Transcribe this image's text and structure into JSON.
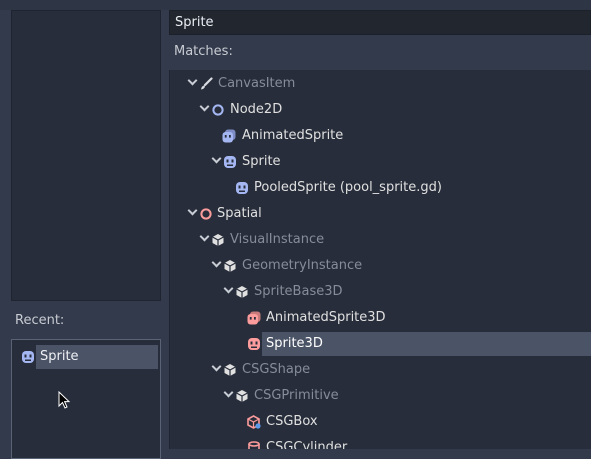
{
  "search": {
    "value": "Sprite"
  },
  "matches_label": "Matches:",
  "recent": {
    "label": "Recent:",
    "items": [
      {
        "label": "Sprite",
        "icon": "sprite-2d-icon"
      }
    ]
  },
  "tree": {
    "rows": [
      {
        "label": "CanvasItem",
        "icon": "brush-icon",
        "disabled": true,
        "arrow": true
      },
      {
        "label": "Node2D",
        "icon": "node2d-circle-icon",
        "disabled": false,
        "arrow": true
      },
      {
        "label": "AnimatedSprite",
        "icon": "animated-sprite-2d-icon",
        "disabled": false,
        "arrow": false
      },
      {
        "label": "Sprite",
        "icon": "sprite-2d-icon",
        "disabled": false,
        "arrow": true
      },
      {
        "label": "PooledSprite (pool_sprite.gd)",
        "icon": "sprite-2d-icon",
        "disabled": false,
        "arrow": false
      },
      {
        "label": "Spatial",
        "icon": "spatial-circle-icon",
        "disabled": false,
        "arrow": true
      },
      {
        "label": "VisualInstance",
        "icon": "cube-icon",
        "disabled": true,
        "arrow": true
      },
      {
        "label": "GeometryInstance",
        "icon": "cube-icon",
        "disabled": true,
        "arrow": true
      },
      {
        "label": "SpriteBase3D",
        "icon": "cube-icon",
        "disabled": true,
        "arrow": true
      },
      {
        "label": "AnimatedSprite3D",
        "icon": "animated-sprite-3d-icon",
        "disabled": false,
        "arrow": false
      },
      {
        "label": "Sprite3D",
        "icon": "sprite-3d-icon",
        "disabled": false,
        "arrow": false,
        "selected": true
      },
      {
        "label": "CSGShape",
        "icon": "cube-icon",
        "disabled": true,
        "arrow": true
      },
      {
        "label": "CSGPrimitive",
        "icon": "cube-icon",
        "disabled": true,
        "arrow": true
      },
      {
        "label": "CSGBox",
        "icon": "csg-box-icon",
        "disabled": false,
        "arrow": false
      },
      {
        "label": "CSGCylinder",
        "icon": "csg-cylinder-icon",
        "disabled": false,
        "arrow": false
      }
    ]
  },
  "colors": {
    "node2d": "#a5b7f3",
    "spatial": "#fc9c9c",
    "disabled_text": "#868c99",
    "selection": "#4b5366"
  }
}
